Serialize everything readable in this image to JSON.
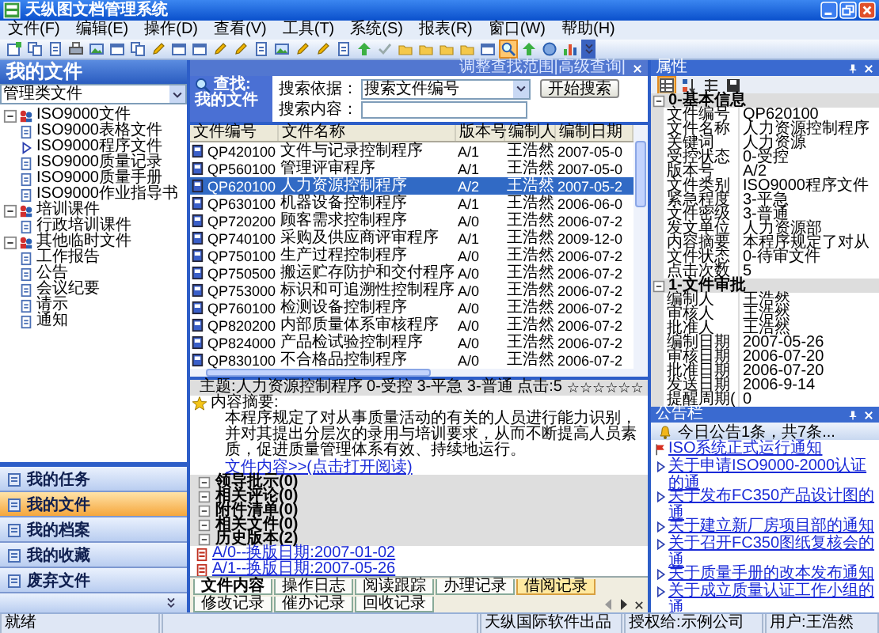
{
  "window": {
    "title": "天纵图文档管理系统"
  },
  "menu": [
    "文件(F)",
    "编辑(E)",
    "操作(D)",
    "查看(V)",
    "工具(T)",
    "系统(S)",
    "报表(R)",
    "窗口(W)",
    "帮助(H)"
  ],
  "toolbar": [
    {
      "kind": "new",
      "selected": false
    },
    {
      "kind": "copy",
      "selected": false
    },
    {
      "kind": "page",
      "selected": false
    },
    {
      "kind": "print",
      "selected": false
    },
    {
      "kind": "image",
      "selected": false
    },
    {
      "kind": "window",
      "selected": false
    },
    {
      "kind": "copy",
      "selected": false
    },
    {
      "kind": "pencil",
      "selected": false
    },
    {
      "kind": "window",
      "selected": false
    },
    {
      "kind": "window",
      "selected": false
    },
    {
      "kind": "pencil",
      "selected": false
    },
    {
      "kind": "pencil",
      "selected": false
    },
    {
      "kind": "page",
      "selected": false
    },
    {
      "kind": "image",
      "selected": false
    },
    {
      "kind": "pencil",
      "selected": false
    },
    {
      "kind": "pencil",
      "selected": false
    },
    {
      "kind": "page",
      "selected": false
    },
    {
      "kind": "arrow",
      "selected": false
    },
    {
      "kind": "check",
      "selected": false
    },
    {
      "kind": "folder",
      "selected": false
    },
    {
      "kind": "folder",
      "selected": false
    },
    {
      "kind": "folder",
      "selected": false
    },
    {
      "kind": "folder",
      "selected": false
    },
    {
      "kind": "window",
      "selected": false
    },
    {
      "kind": "search",
      "selected": true
    },
    {
      "kind": "arrow",
      "selected": false
    },
    {
      "kind": "circle",
      "selected": false
    },
    {
      "kind": "bars",
      "selected": false
    }
  ],
  "left_panel": {
    "title": "我的文件",
    "filter": "管理类文件",
    "tree": [
      {
        "label": "ISO9000文件",
        "expanded": true,
        "children": [
          {
            "label": "ISO9000表格文件",
            "selected": false
          },
          {
            "label": "ISO9000程序文件",
            "selected": true
          },
          {
            "label": "ISO9000质量记录",
            "selected": false
          },
          {
            "label": "ISO9000质量手册",
            "selected": false
          },
          {
            "label": "ISO9000作业指导书",
            "selected": false
          }
        ]
      },
      {
        "label": "培训课件",
        "expanded": true,
        "children": [
          {
            "label": "行政培训课件",
            "selected": false
          }
        ]
      },
      {
        "label": "其他临时文件",
        "expanded": true,
        "children": [
          {
            "label": "工作报告",
            "selected": false
          },
          {
            "label": "公告",
            "selected": false
          },
          {
            "label": "会议纪要",
            "selected": false
          },
          {
            "label": "请示",
            "selected": false
          },
          {
            "label": "通知",
            "selected": false
          }
        ]
      }
    ],
    "nav": [
      {
        "label": "我的任务",
        "selected": false
      },
      {
        "label": "我的文件",
        "selected": true
      },
      {
        "label": "我的档案",
        "selected": false
      },
      {
        "label": "我的收藏",
        "selected": false
      },
      {
        "label": "废弃文件",
        "selected": false
      }
    ]
  },
  "search": {
    "links": "调整查找范围|高级查询|",
    "title_lines": [
      "查找:",
      "我的文件"
    ],
    "basis_label": "搜索依据：",
    "basis_value": "搜索文件编号",
    "button": "开始搜索",
    "content_label": "搜索内容："
  },
  "table": {
    "columns": [
      "文件编号",
      "文件名称",
      "版本号",
      "编制人",
      "编制日期"
    ],
    "rows": [
      {
        "cells": [
          "QP420100",
          "文件与记录控制程序",
          "A/1",
          "王浩然",
          "2007-05-0"
        ],
        "selected": false
      },
      {
        "cells": [
          "QP560100",
          "管理评审程序",
          "A/1",
          "王浩然",
          "2007-05-0"
        ],
        "selected": false
      },
      {
        "cells": [
          "QP620100",
          "人力资源控制程序",
          "A/2",
          "王浩然",
          "2007-05-2"
        ],
        "selected": true
      },
      {
        "cells": [
          "QP630100",
          "机器设备控制程序",
          "A/1",
          "王浩然",
          "2006-06-0"
        ],
        "selected": false
      },
      {
        "cells": [
          "QP720200",
          "顾客需求控制程序",
          "A/0",
          "王浩然",
          "2006-07-2"
        ],
        "selected": false
      },
      {
        "cells": [
          "QP740100",
          "采购及供应商评审程序",
          "A/1",
          "王浩然",
          "2009-12-0"
        ],
        "selected": false
      },
      {
        "cells": [
          "QP750100",
          "生产过程控制程序",
          "A/0",
          "王浩然",
          "2006-07-2"
        ],
        "selected": false
      },
      {
        "cells": [
          "QP750500",
          "搬运贮存防护和交付程序",
          "A/0",
          "王浩然",
          "2006-07-2"
        ],
        "selected": false
      },
      {
        "cells": [
          "QP753000",
          "标识和可追溯性控制程序",
          "A/0",
          "王浩然",
          "2006-07-2"
        ],
        "selected": false
      },
      {
        "cells": [
          "QP760100",
          "检测设备控制程序",
          "A/0",
          "王浩然",
          "2006-07-2"
        ],
        "selected": false
      },
      {
        "cells": [
          "QP820200",
          "内部质量体系审核程序",
          "A/0",
          "王浩然",
          "2006-07-2"
        ],
        "selected": false
      },
      {
        "cells": [
          "QP824000",
          "产品检试验控制程序",
          "A/0",
          "王浩然",
          "2006-07-2"
        ],
        "selected": false
      },
      {
        "cells": [
          "QP830100",
          "不合格品控制程序",
          "A/0",
          "王浩然",
          "2006-07-2"
        ],
        "selected": false
      }
    ]
  },
  "detail": {
    "subject": "主题:人力资源控制程序 0-受控 3-平急 3-普通 点击:5",
    "rating": "☆☆☆☆☆☆",
    "summary_label": "内容摘要:",
    "summary": "本程序规定了对从事质量活动的有关的人员进行能力识别，并对其提出分层次的录用与培训要求，从而不断提高人员素质，促进质量管理体系有效、持续地运行。",
    "link": "文件内容>>(点击打开阅读)",
    "sections": [
      {
        "label": "领导批示(0)",
        "expanded": true
      },
      {
        "label": "相关评论(0)",
        "expanded": true
      },
      {
        "label": "附件清单(0)",
        "expanded": true
      },
      {
        "label": "相关文件(0)",
        "expanded": true
      },
      {
        "label": "历史版本(2)",
        "expanded": true
      }
    ],
    "history": [
      "A/0--换版日期:2007-01-02",
      "A/1--换版日期:2007-05-26"
    ],
    "tabs": [
      {
        "label": "文件内容",
        "selected": true,
        "highlighted": false
      },
      {
        "label": "操作日志",
        "selected": false,
        "highlighted": false
      },
      {
        "label": "阅读跟踪",
        "selected": false,
        "highlighted": false
      },
      {
        "label": "办理记录",
        "selected": false,
        "highlighted": false
      },
      {
        "label": "借阅记录",
        "selected": false,
        "highlighted": true
      },
      {
        "label": "修改记录",
        "selected": false,
        "highlighted": false
      },
      {
        "label": "催办记录",
        "selected": false,
        "highlighted": false
      },
      {
        "label": "回收记录",
        "selected": false,
        "highlighted": false
      }
    ]
  },
  "properties": {
    "title": "属性",
    "tools": [
      {
        "kind": "grid",
        "selected": true
      },
      {
        "kind": "sort",
        "selected": false
      },
      {
        "kind": "list",
        "selected": false
      },
      {
        "kind": "disk",
        "selected": false
      }
    ],
    "groups": [
      {
        "label": "0-基本信息",
        "expanded": true,
        "rows": [
          {
            "name": "文件编号",
            "value": "QP620100"
          },
          {
            "name": "文件名称",
            "value": "人力资源控制程序"
          },
          {
            "name": "关键词",
            "value": "人力资源"
          },
          {
            "name": "受控状态",
            "value": "0-受控"
          },
          {
            "name": "版本号",
            "value": "A/2"
          },
          {
            "name": "文件类别",
            "value": "ISO9000程序文件"
          },
          {
            "name": "紧急程度",
            "value": "3-平急"
          },
          {
            "name": "文件密级",
            "value": "3-普通"
          },
          {
            "name": "发文单位",
            "value": "人力资源部"
          },
          {
            "name": "内容摘要",
            "value": "本程序规定了对从"
          },
          {
            "name": "文件状态",
            "value": "0-待审文件"
          },
          {
            "name": "点击次数",
            "value": "5"
          }
        ]
      },
      {
        "label": "1-文件审批",
        "expanded": true,
        "rows": [
          {
            "name": "编制人",
            "value": "王浩然"
          },
          {
            "name": "审核人",
            "value": "王浩然"
          },
          {
            "name": "批准人",
            "value": "王浩然"
          },
          {
            "name": "编制日期",
            "value": "2007-05-26"
          },
          {
            "name": "审核日期",
            "value": "2006-07-20"
          },
          {
            "name": "批准日期",
            "value": "2006-07-20"
          },
          {
            "name": "发送日期",
            "value": "2006-9-14"
          },
          {
            "name": "提醒周期(",
            "value": "0"
          }
        ]
      }
    ]
  },
  "announcements": {
    "title": "公告栏",
    "summary": "今日公告1条，共7条...",
    "items": [
      {
        "text": "ISO系统正式运行通知",
        "kind": "flag"
      },
      {
        "text": "关于申请ISO9000-2000认证的通",
        "kind": "arrow"
      },
      {
        "text": "关于发布FC350产品设计图的通",
        "kind": "arrow"
      },
      {
        "text": "关于建立新厂房项目部的通知",
        "kind": "arrow"
      },
      {
        "text": "关于召开FC350图纸复核会的通",
        "kind": "arrow"
      },
      {
        "text": "关于质量手册的改本发布通知",
        "kind": "arrow"
      },
      {
        "text": "关于成立质量认证工作小组的通",
        "kind": "arrow"
      }
    ]
  },
  "status_bar": [
    "就绪",
    "天纵国际软件出品",
    "授权给:示例公司",
    "用户:王浩然"
  ]
}
